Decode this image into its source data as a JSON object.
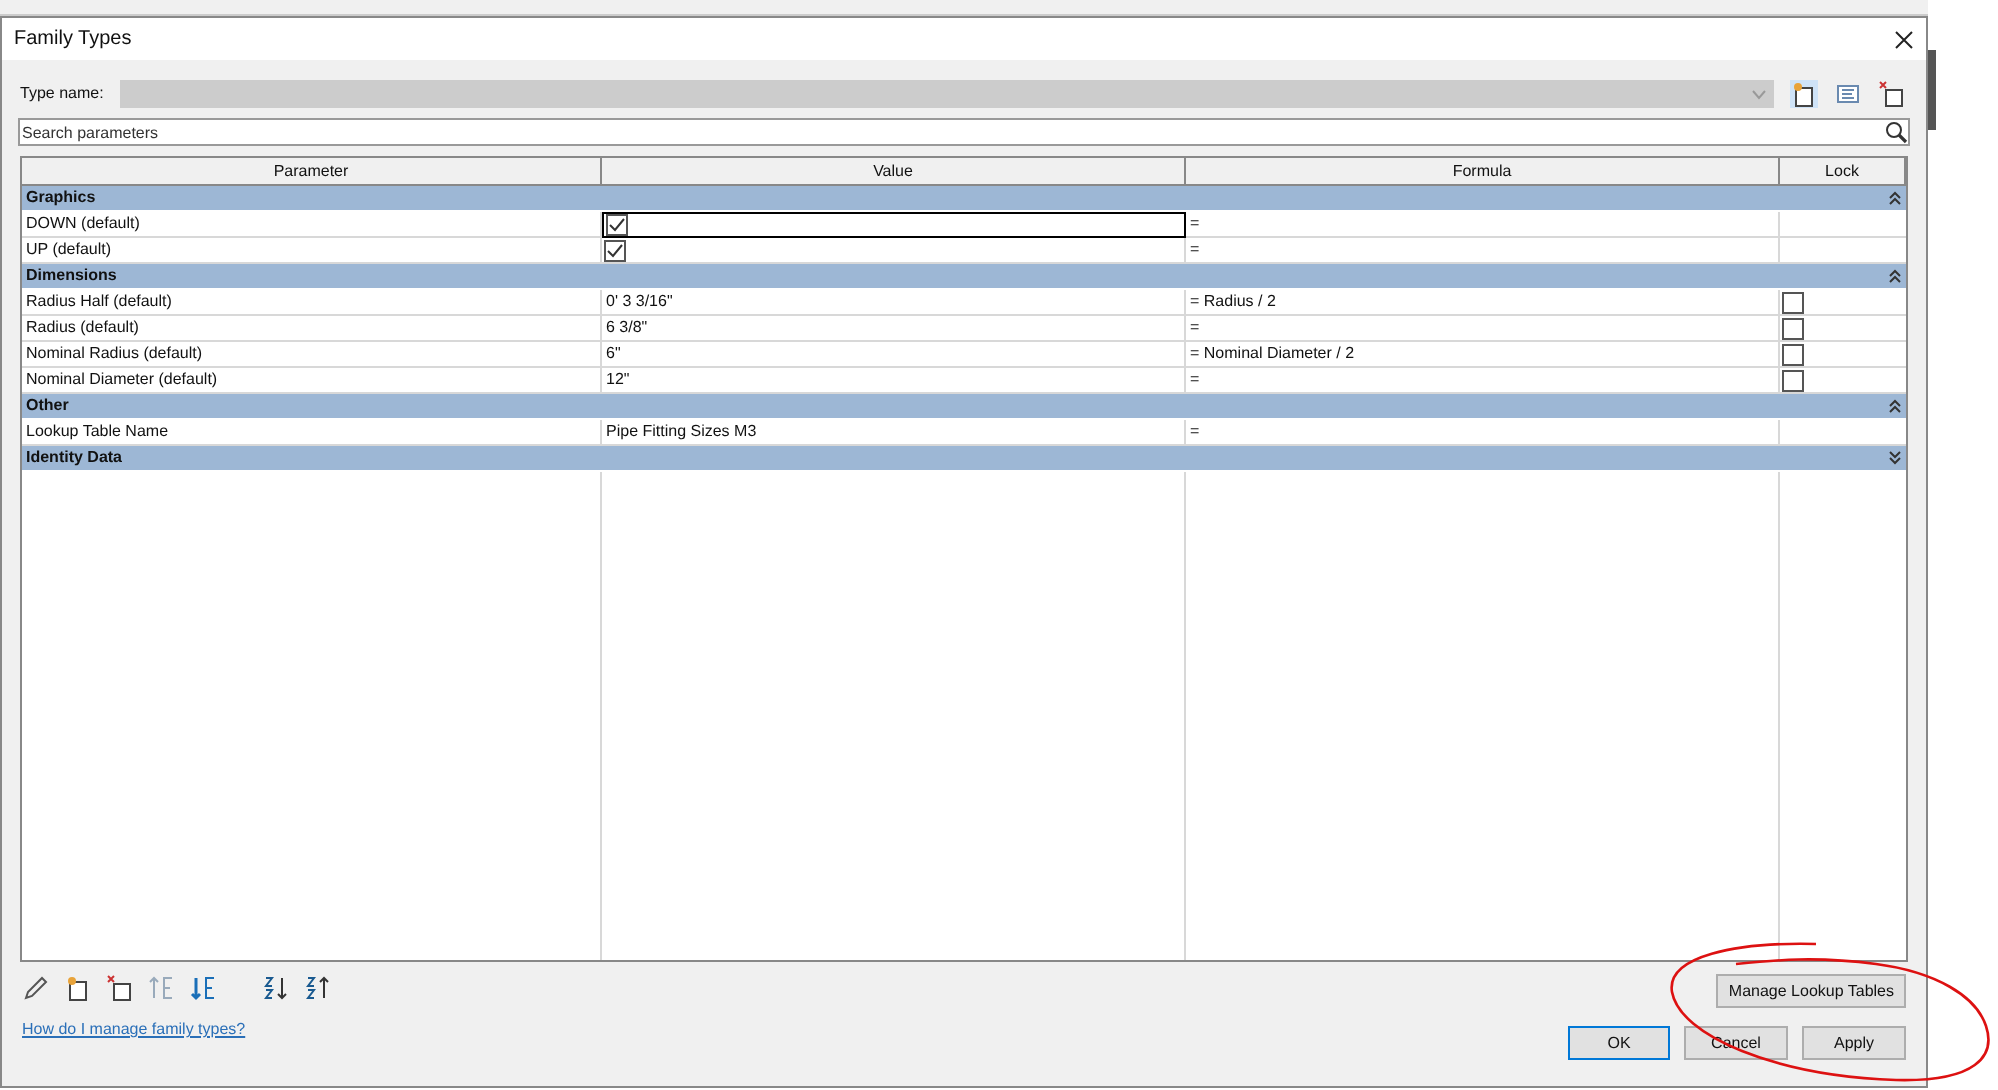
{
  "window": {
    "title": "Family Types"
  },
  "type_name": {
    "label": "Type name:",
    "disabled": true
  },
  "search": {
    "placeholder": "Search parameters"
  },
  "table": {
    "columns": [
      "Parameter",
      "Value",
      "Formula",
      "Lock"
    ],
    "groups": [
      {
        "name": "Graphics",
        "expanded": true,
        "rows": [
          {
            "parameter": "DOWN (default)",
            "kind": "checkbox",
            "checked": true,
            "formula": "=",
            "lock": false,
            "selected": true
          },
          {
            "parameter": "UP (default)",
            "kind": "checkbox",
            "checked": true,
            "formula": "=",
            "lock": false,
            "selected": false
          }
        ]
      },
      {
        "name": "Dimensions",
        "expanded": true,
        "rows": [
          {
            "parameter": "Radius Half (default)",
            "kind": "text",
            "value": "0'  3 3/16\"",
            "formula": "= Radius / 2",
            "lock": true,
            "locked": false,
            "selected": false
          },
          {
            "parameter": "Radius (default)",
            "kind": "text",
            "value": "6 3/8\"",
            "formula": "=",
            "lock": true,
            "locked": false,
            "selected": false
          },
          {
            "parameter": "Nominal Radius (default)",
            "kind": "text",
            "value": "6\"",
            "formula": "= Nominal Diameter / 2",
            "lock": true,
            "locked": false,
            "selected": false
          },
          {
            "parameter": "Nominal Diameter (default)",
            "kind": "text",
            "value": "12\"",
            "formula": "=",
            "lock": true,
            "locked": false,
            "selected": false
          }
        ]
      },
      {
        "name": "Other",
        "expanded": true,
        "rows": [
          {
            "parameter": "Lookup Table Name",
            "kind": "text",
            "value": "Pipe Fitting Sizes M3",
            "formula": "=",
            "lock": false,
            "selected": false
          }
        ]
      },
      {
        "name": "Identity Data",
        "expanded": false
      }
    ]
  },
  "help_link": "How do I manage family types?",
  "buttons": {
    "manage": "Manage Lookup Tables",
    "ok": "OK",
    "cancel": "Cancel",
    "apply": "Apply"
  }
}
